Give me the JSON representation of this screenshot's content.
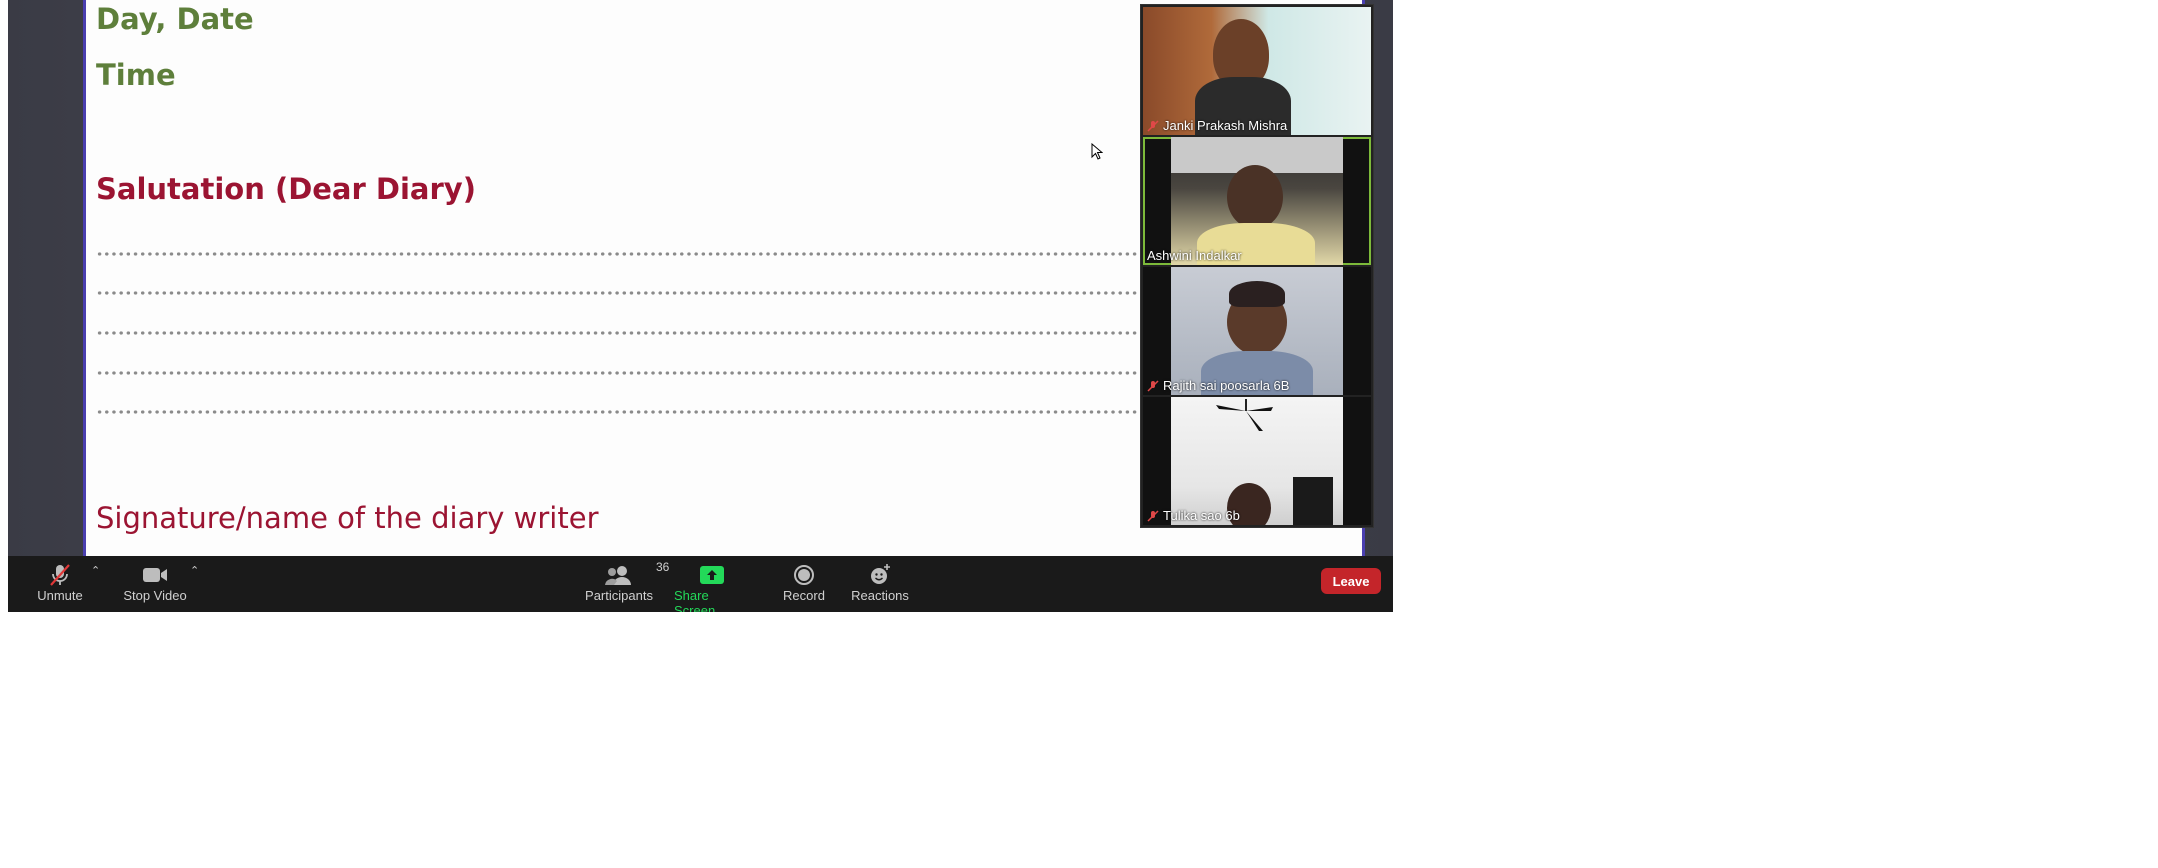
{
  "slide": {
    "day_date": "Day, Date",
    "time": "Time",
    "salutation": "Salutation (Dear Diary)",
    "signature": "Signature/name of the diary writer",
    "dotted_lines": 5
  },
  "participants_gallery": [
    {
      "name": "Janki Prakash Mishra",
      "muted": true,
      "active_speaker": false
    },
    {
      "name": "Ashwini Indalkar",
      "muted": false,
      "active_speaker": true
    },
    {
      "name": "Rajith sai poosarla 6B",
      "muted": true,
      "active_speaker": false
    },
    {
      "name": "Tulika sao 6b",
      "muted": true,
      "active_speaker": false
    }
  ],
  "toolbar": {
    "unmute_label": "Unmute",
    "stop_video_label": "Stop Video",
    "participants_label": "Participants",
    "participants_count": "36",
    "share_screen_label": "Share Screen",
    "record_label": "Record",
    "reactions_label": "Reactions",
    "leave_label": "Leave"
  },
  "colors": {
    "heading_green": "#5e7f3b",
    "heading_maroon": "#9b1432",
    "share_screen_green": "#23d959",
    "leave_red": "#c4252a",
    "active_speaker_border": "#7dba3a"
  }
}
